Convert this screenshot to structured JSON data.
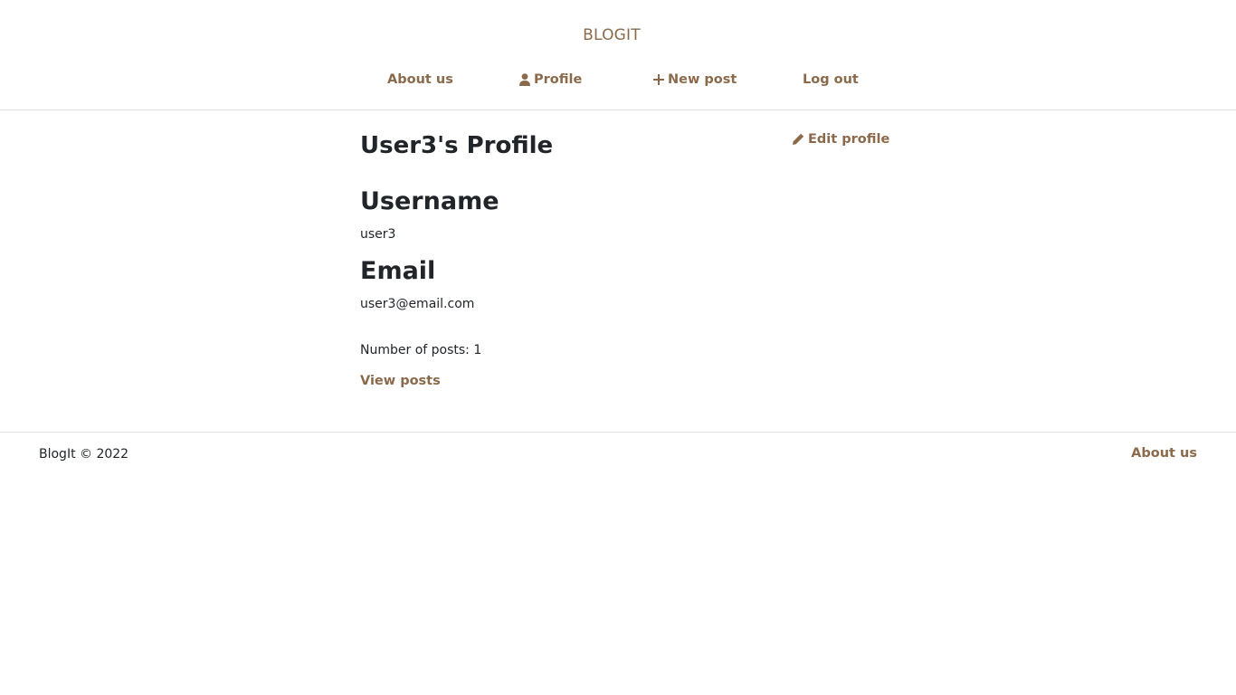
{
  "header": {
    "brand": "BLOGIT",
    "nav": {
      "about": "About us",
      "profile": "Profile",
      "new_post": "New post",
      "logout": "Log out"
    }
  },
  "profile": {
    "title": "User3's Profile",
    "edit_label": "Edit profile",
    "username_heading": "Username",
    "username_value": "user3",
    "email_heading": "Email",
    "email_value": "user3@email.com",
    "posts_count_text": "Number of posts: 1",
    "view_posts_label": "View posts"
  },
  "footer": {
    "copyright": "BlogIt © 2022",
    "about_label": "About us"
  },
  "colors": {
    "accent": "#8b6a4b",
    "text": "#212529",
    "divider": "#dee2e6"
  },
  "icons": {
    "profile": "user-icon",
    "new_post": "plus-icon",
    "edit": "pencil-icon"
  }
}
